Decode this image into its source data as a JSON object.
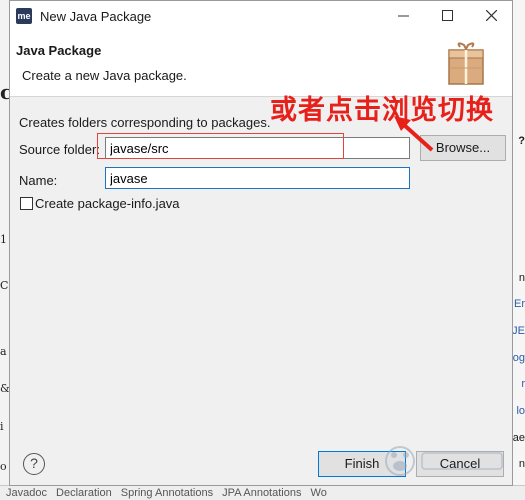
{
  "dialog": {
    "title": "New Java Package",
    "app_icon": "me",
    "banner_title": "Java Package",
    "banner_description": "Create a new Java package.",
    "section_text": "Creates folders corresponding to packages.",
    "source_folder_label": "Source folder:",
    "source_folder_value": "javase/src",
    "browse_label": "Browse...",
    "name_label": "Name:",
    "name_value": "javase",
    "create_info_label": "Create package-info.java",
    "create_info_checked": false,
    "finish_label": "Finish",
    "cancel_label": "Cancel",
    "help_icon": "?"
  },
  "annotation": {
    "text": "或者点击浏览切换",
    "color": "#e8201a"
  },
  "background": {
    "left_fragments": [
      "c",
      "1",
      "C",
      "a",
      "&",
      "i",
      "o"
    ],
    "right_fragments": [
      "?",
      "n",
      "Er",
      "JE",
      "og",
      "r",
      "lo",
      "ae",
      "n"
    ],
    "bottom_tabs": [
      "Javadoc",
      "Declaration",
      "Spring Annotations",
      "JPA Annotations",
      "Wo"
    ]
  },
  "window_controls": [
    "minimize-icon",
    "maximize-icon",
    "close-icon"
  ]
}
